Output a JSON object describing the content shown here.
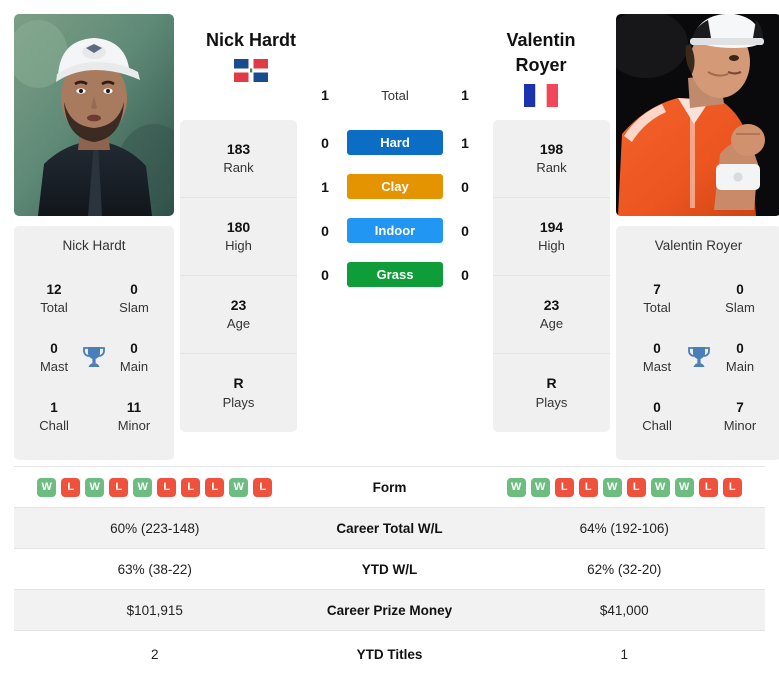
{
  "players": {
    "left": {
      "name": "Nick Hardt",
      "flag": "dominican-republic-flag",
      "caption": "Nick Hardt",
      "titles": {
        "total_value": "12",
        "total_label": "Total",
        "slam_value": "0",
        "slam_label": "Slam",
        "mast_value": "0",
        "mast_label": "Mast",
        "main_value": "0",
        "main_label": "Main",
        "chall_value": "1",
        "chall_label": "Chall",
        "minor_value": "11",
        "minor_label": "Minor"
      },
      "stats": [
        {
          "value": "183",
          "label": "Rank"
        },
        {
          "value": "180",
          "label": "High"
        },
        {
          "value": "23",
          "label": "Age"
        },
        {
          "value": "R",
          "label": "Plays"
        }
      ],
      "h2h": {
        "total": "1",
        "hard": "0",
        "clay": "1",
        "indoor": "0",
        "grass": "0"
      },
      "form": [
        "W",
        "L",
        "W",
        "L",
        "W",
        "L",
        "L",
        "L",
        "W",
        "L"
      ],
      "career_total_wl": "60% (223-148)",
      "ytd_wl": "63% (38-22)",
      "career_prize_money": "$101,915",
      "ytd_titles": "2"
    },
    "right": {
      "name_line1": "Valentin",
      "name_line2": "Royer",
      "flag": "france-flag",
      "caption": "Valentin Royer",
      "titles": {
        "total_value": "7",
        "total_label": "Total",
        "slam_value": "0",
        "slam_label": "Slam",
        "mast_value": "0",
        "mast_label": "Mast",
        "main_value": "0",
        "main_label": "Main",
        "chall_value": "0",
        "chall_label": "Chall",
        "minor_value": "7",
        "minor_label": "Minor"
      },
      "stats": [
        {
          "value": "198",
          "label": "Rank"
        },
        {
          "value": "194",
          "label": "High"
        },
        {
          "value": "23",
          "label": "Age"
        },
        {
          "value": "R",
          "label": "Plays"
        }
      ],
      "h2h": {
        "total": "1",
        "hard": "1",
        "clay": "0",
        "indoor": "0",
        "grass": "0"
      },
      "form": [
        "W",
        "W",
        "L",
        "L",
        "W",
        "L",
        "W",
        "W",
        "L",
        "L"
      ],
      "career_total_wl": "64% (192-106)",
      "ytd_wl": "62% (32-20)",
      "career_prize_money": "$41,000",
      "ytd_titles": "1"
    }
  },
  "center": {
    "total_label": "Total",
    "surfaces": [
      {
        "label": "Hard",
        "color": "#0b6ec4"
      },
      {
        "label": "Clay",
        "color": "#e39400"
      },
      {
        "label": "Indoor",
        "color": "#2196f3"
      },
      {
        "label": "Grass",
        "color": "#0f9d3a"
      }
    ]
  },
  "table": {
    "rows": [
      {
        "label": "Form"
      },
      {
        "label": "Career Total W/L"
      },
      {
        "label": "YTD W/L"
      },
      {
        "label": "Career Prize Money"
      },
      {
        "label": "YTD Titles"
      }
    ]
  },
  "colors": {
    "card_bg": "#f0f0f0",
    "row_shade": "#f2f2f2",
    "win_badge": "#6cbd7f",
    "loss_badge": "#f0513c",
    "trophy": "#4a7ebb"
  }
}
